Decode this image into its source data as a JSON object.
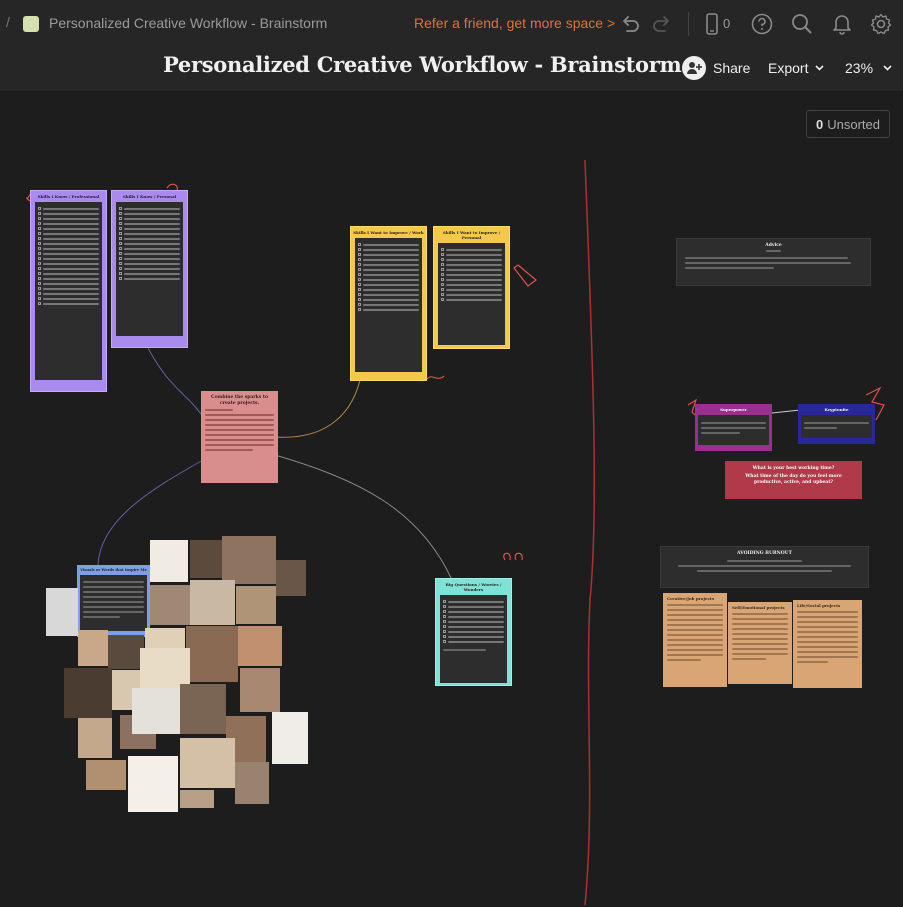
{
  "topbar": {
    "breadcrumb": "Personalized Creative Workflow - Brainstorm",
    "refer_link": "Refer a friend, get more space >",
    "device_count": "0"
  },
  "header": {
    "title": "Personalized Creative Workflow - Brainstorm",
    "share_label": "Share",
    "export_label": "Export",
    "zoom_label": "23%"
  },
  "unsorted": {
    "count": "0",
    "label": "Unsorted"
  },
  "cards": {
    "skills_pro": "Skills I Know / Professional",
    "skills_personal": "Skills I Know / Personal",
    "improve_work": "Skills I Want to Improve / Work",
    "improve_personal": "Skills I Want to Improve / Personal",
    "combine": "Combine the sparks to create projects.",
    "visuals": "Visuals or Words that Inspire Me",
    "big_questions": "Big Questions / Worries / Wonders",
    "advice": "Advice",
    "superpower": "Superpower",
    "kryptonite": "Kryptonite",
    "working_time_1": "What is your best working time?",
    "working_time_2": "What time of the day do you feel more productive, active, and upbeat?",
    "burnout": "AVOIDING BURNOUT",
    "creative_job": "Creative/Job projects",
    "self_emotional": "Self/Emotional projects",
    "life_social": "Life/Social projects"
  },
  "colors": {
    "accent_orange": "#e07040",
    "purple": "#a98bf0",
    "yellow": "#f3c84b",
    "pink": "#d98e8e",
    "teal": "#7ee3d6",
    "magenta": "#9b2f8f",
    "navy": "#28289a",
    "red": "#b03a4a",
    "tan": "#d9a574",
    "divider_red": "#b03030"
  }
}
